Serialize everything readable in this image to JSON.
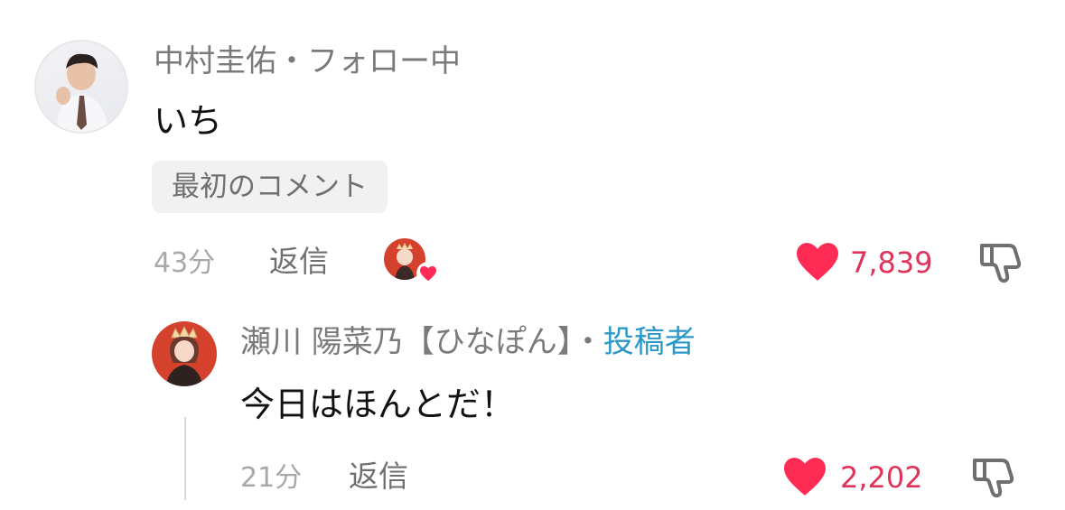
{
  "comment": {
    "username": "中村圭佑・フォロー中",
    "text": "いち",
    "badge": "最初のコメント",
    "time": "43分",
    "reply_label": "返信",
    "likes": "7,839",
    "liked_by_creator": true,
    "avatar_icon": "user-avatar",
    "like_icon": "heart-icon",
    "dislike_icon": "thumbs-down-icon"
  },
  "reply": {
    "username": "瀬川  陽菜乃【ひなぽん】",
    "separator": "・",
    "author_label": "投稿者",
    "text": "今日はほんとだ！",
    "time": "21分",
    "reply_label": "返信",
    "likes": "2,202",
    "avatar_icon": "user-avatar",
    "like_icon": "heart-icon",
    "dislike_icon": "thumbs-down-icon"
  },
  "colors": {
    "like": "#fe2c55",
    "author": "#2a98c9",
    "muted": "#7a7a7a",
    "badge_bg": "#f1f1f1"
  }
}
